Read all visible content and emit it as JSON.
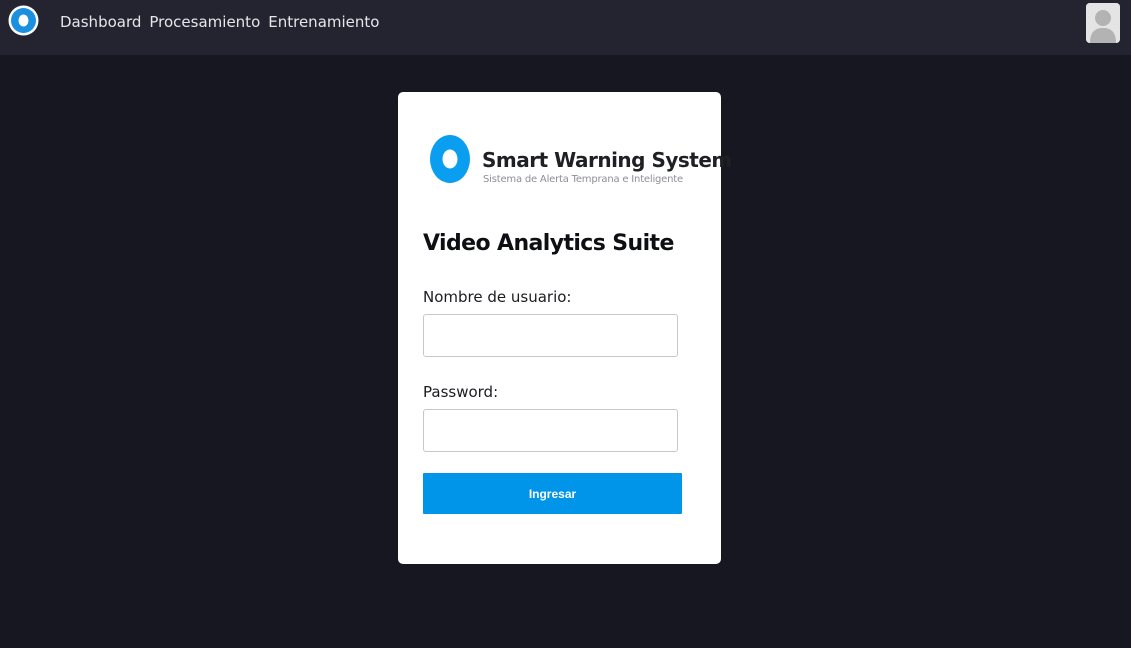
{
  "nav": {
    "items": [
      {
        "label": "Dashboard"
      },
      {
        "label": "Procesamiento"
      },
      {
        "label": "Entrenamiento"
      }
    ]
  },
  "login": {
    "brand_name": "Smart Warning System",
    "brand_tagline": "Sistema de Alerta Temprana e Inteligente",
    "title": "Video Analytics Suite",
    "username_label": "Nombre de usuario:",
    "username_value": "",
    "password_label": "Password:",
    "password_value": "",
    "submit_label": "Ingresar"
  },
  "colors": {
    "background": "#161720",
    "topbar": "#23242f",
    "accent": "#0195ea"
  },
  "icons": {
    "app_logo": "ring-logo-icon",
    "user": "user-avatar-icon"
  }
}
